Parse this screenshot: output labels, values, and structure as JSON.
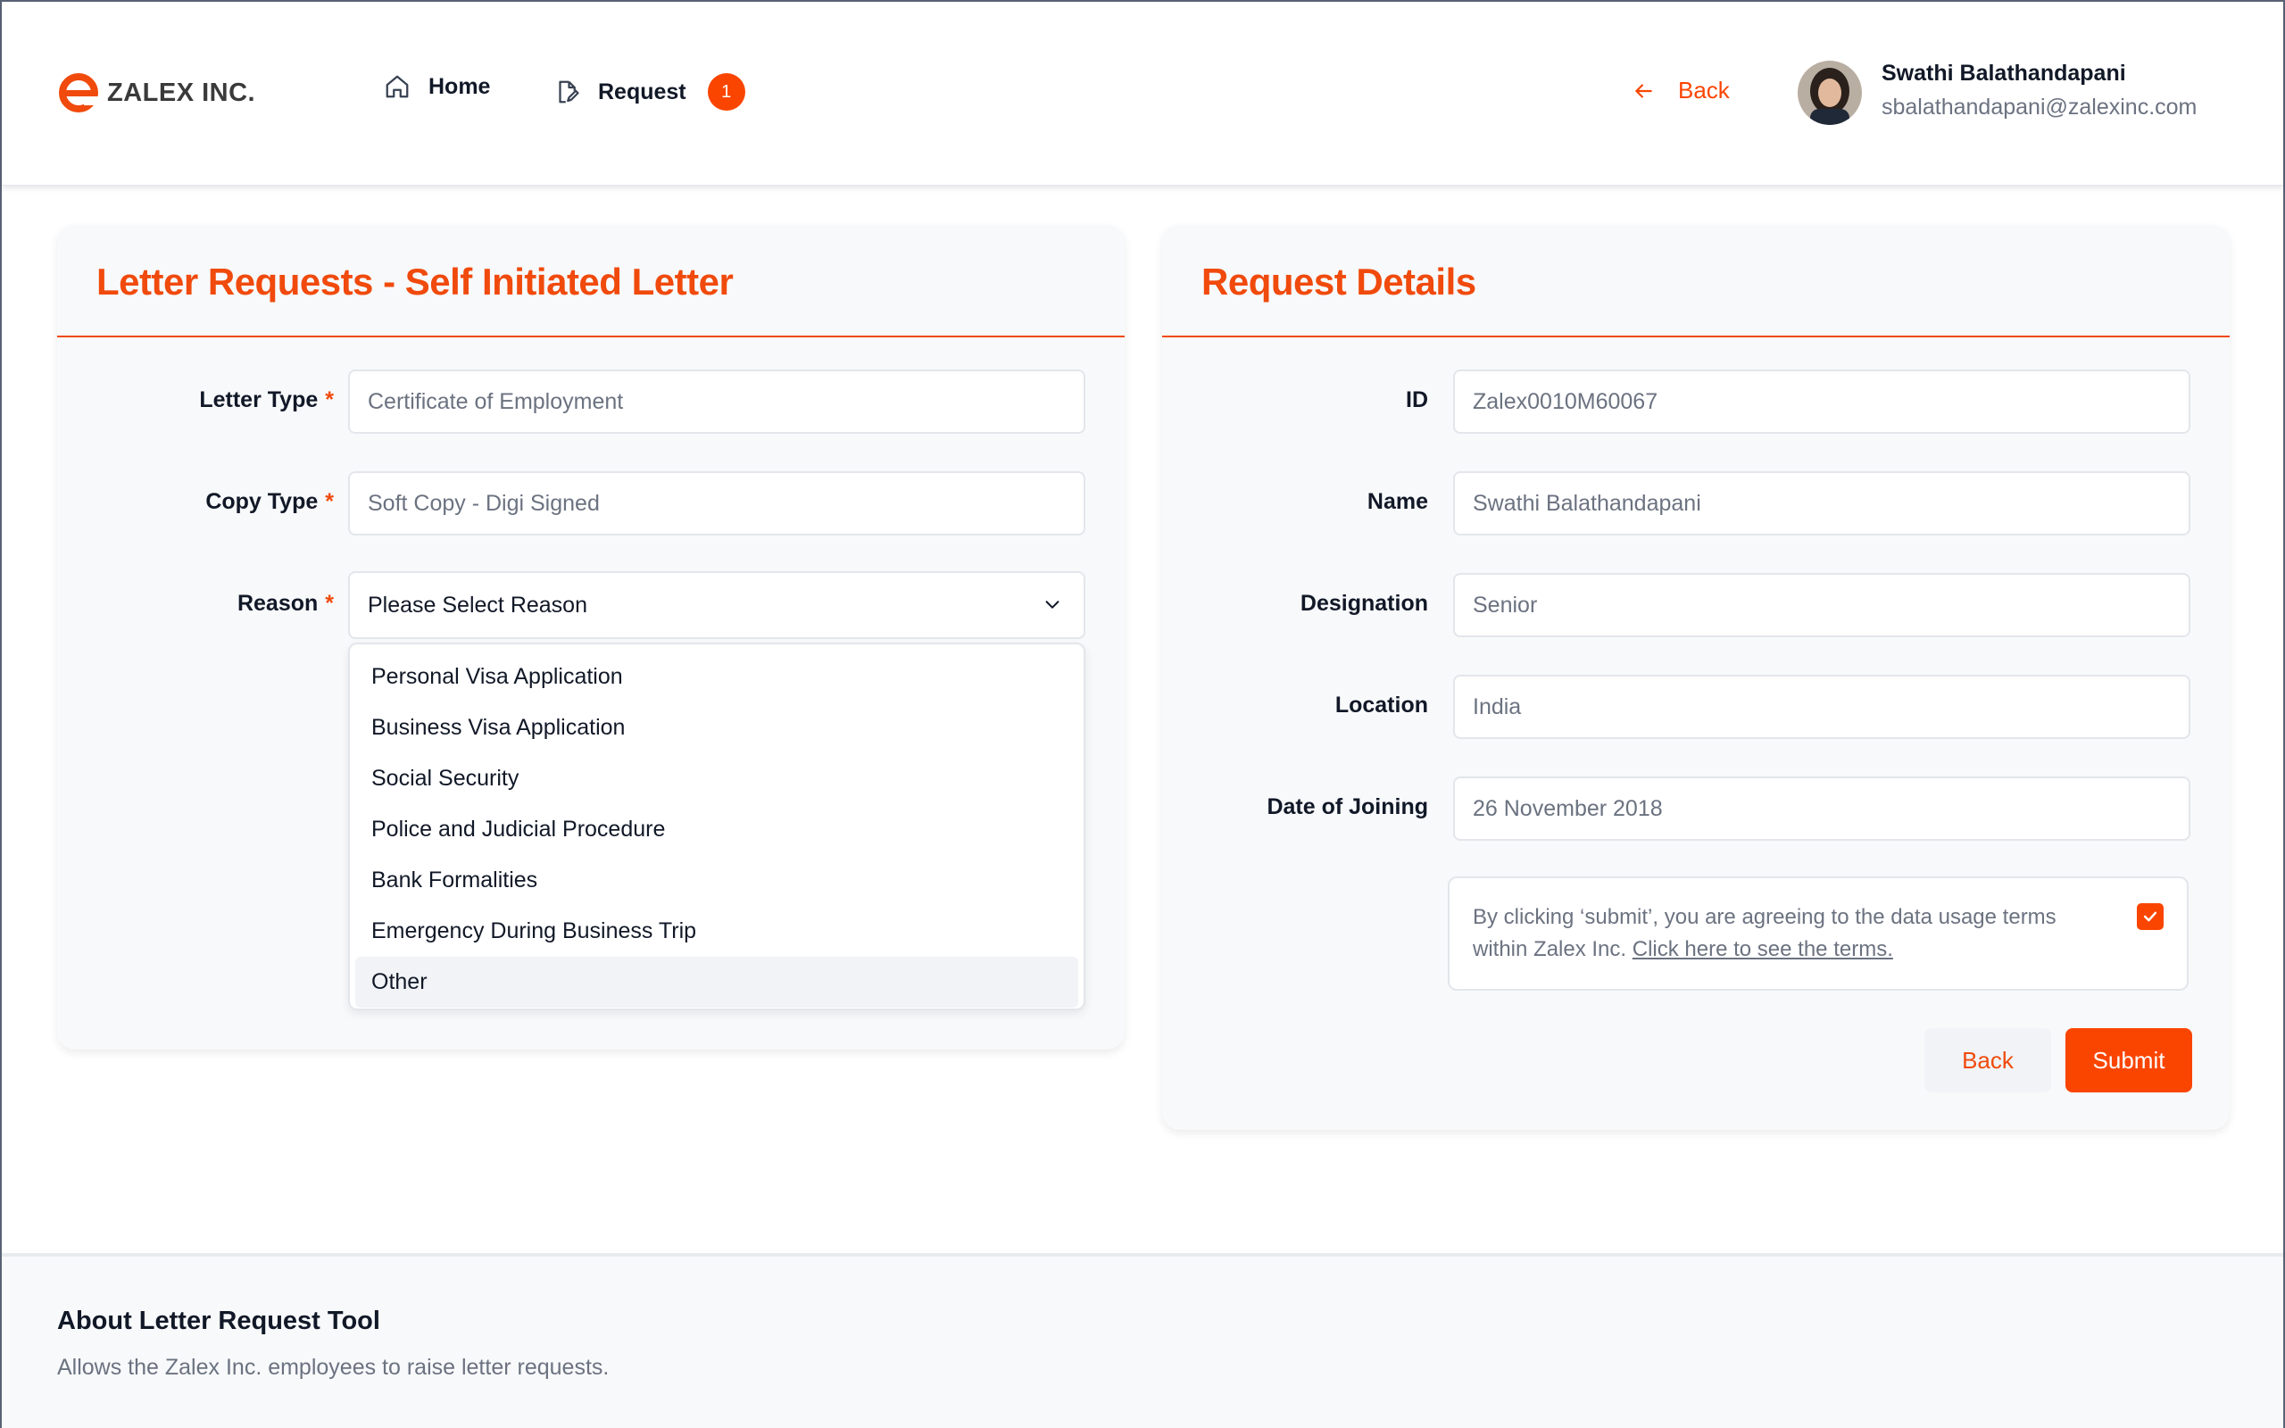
{
  "header": {
    "brand": "ZALEX INC.",
    "nav": [
      {
        "label": "Home",
        "icon": "home-icon"
      },
      {
        "label": "Request",
        "icon": "document-edit-icon",
        "badge": "1"
      }
    ],
    "back_label": "Back",
    "user": {
      "name": "Swathi Balathandapani",
      "email": "sbalathandapani@zalexinc.com"
    }
  },
  "letter_form": {
    "title": "Letter Requests - Self Initiated Letter",
    "required_mark": "*",
    "fields": {
      "letter_type": {
        "label": "Letter Type",
        "value": "Certificate of Employment"
      },
      "copy_type": {
        "label": "Copy Type",
        "value": "Soft Copy - Digi Signed"
      },
      "reason": {
        "label": "Reason",
        "value": "Please Select Reason"
      }
    },
    "reason_options": [
      "Personal Visa Application",
      "Business Visa Application",
      "Social Security",
      "Police and Judicial Procedure",
      "Bank Formalities",
      "Emergency During Business Trip",
      "Other"
    ],
    "highlighted_option": "Other"
  },
  "request_details": {
    "title": "Request Details",
    "fields": {
      "id": {
        "label": "ID",
        "value": "Zalex0010M60067"
      },
      "name": {
        "label": "Name",
        "value": "Swathi Balathandapani"
      },
      "designation": {
        "label": "Designation",
        "value": "Senior"
      },
      "location": {
        "label": "Location",
        "value": "India"
      },
      "doj": {
        "label": "Date of Joining",
        "value": "26 November 2018"
      }
    },
    "terms_text": "By clicking ‘submit’, you are agreeing to the data usage terms within Zalex Inc.",
    "terms_link": "Click here to see the terms.",
    "terms_checked": true,
    "back_button": "Back",
    "submit_button": "Submit"
  },
  "footer": {
    "title": "About Letter Request Tool",
    "text": "Allows the Zalex Inc. employees to raise letter requests."
  },
  "colors": {
    "accent": "#fa4500",
    "accent_text": "#f04a0c"
  }
}
